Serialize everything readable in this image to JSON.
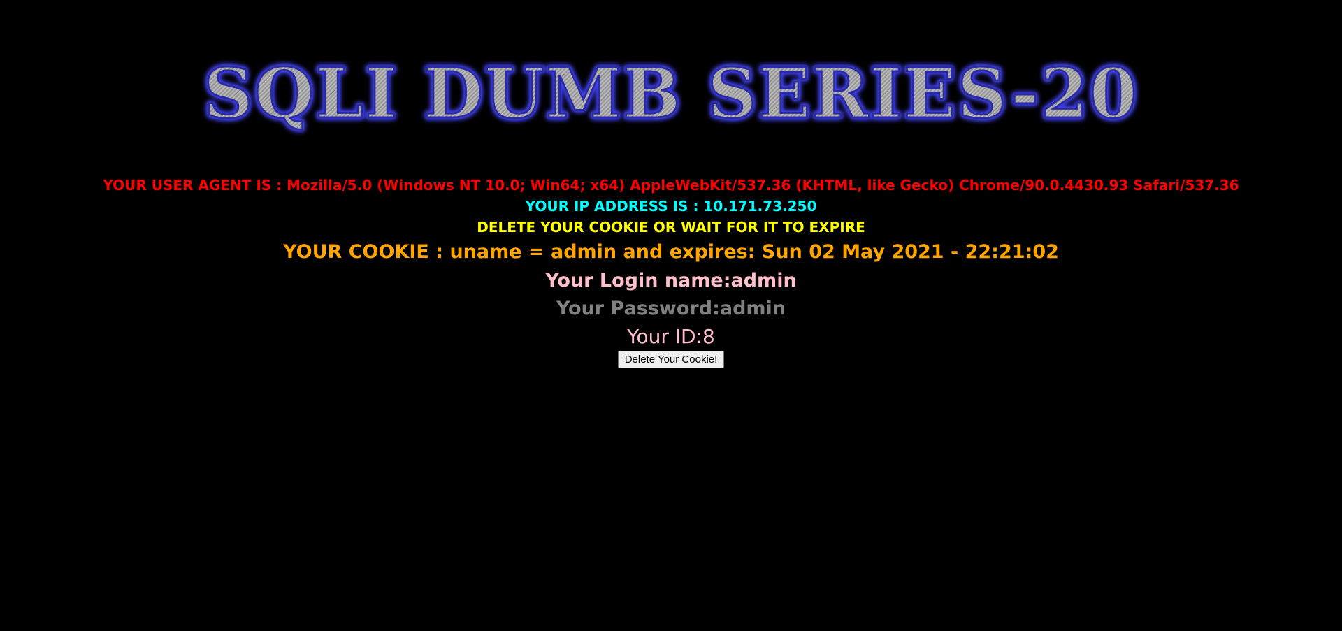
{
  "banner": {
    "title": "SQLI DUMB SERIES-20"
  },
  "info": {
    "user_agent": "YOUR USER AGENT IS : Mozilla/5.0 (Windows NT 10.0; Win64; x64) AppleWebKit/537.36 (KHTML, like Gecko) Chrome/90.0.4430.93 Safari/537.36",
    "ip_address": "YOUR IP ADDRESS IS : 10.171.73.250",
    "delete_notice": "DELETE YOUR COOKIE OR WAIT FOR IT TO EXPIRE",
    "cookie": "YOUR COOKIE : uname = admin and expires: Sun 02 May 2021 - 22:21:02",
    "login_name": "Your Login name:admin",
    "password": "Your Password:admin",
    "user_id": "Your ID:8"
  },
  "form": {
    "delete_button_label": "Delete Your Cookie!"
  },
  "colors": {
    "background": "#000000",
    "user_agent": "#ff0000",
    "ip_address": "#00ffff",
    "delete_notice": "#ffff00",
    "cookie": "#ffa500",
    "login_name": "#ffc0cb",
    "password": "#808080",
    "user_id": "#ffc0cb"
  }
}
